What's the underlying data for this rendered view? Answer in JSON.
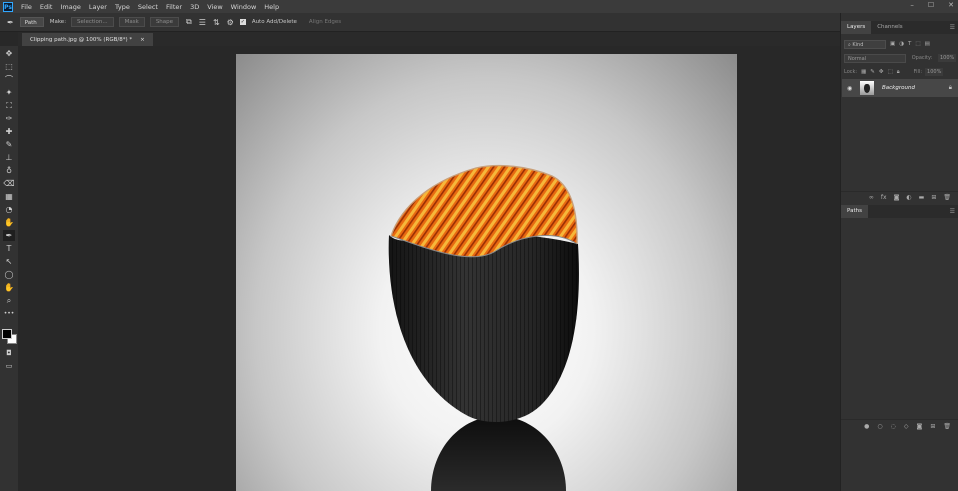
{
  "app": {
    "logo": "Ps"
  },
  "menu": [
    "File",
    "Edit",
    "Image",
    "Layer",
    "Type",
    "Select",
    "Filter",
    "3D",
    "View",
    "Window",
    "Help"
  ],
  "window_controls": [
    "–",
    "☐",
    "✕"
  ],
  "options": {
    "mode": "Path",
    "make_label": "Make:",
    "selection_btn": "Selection...",
    "mask_btn": "Mask",
    "shape_btn": "Shape",
    "auto_add_delete": "Auto Add/Delete",
    "align_edges": "Align Edges"
  },
  "document": {
    "tab_title": "Clipping path.jpg @ 100% (RGB/8*) *",
    "close": "×"
  },
  "tools": [
    "✥",
    "⬚",
    "⌒",
    "✦",
    "⛶",
    "✑",
    "✚",
    "✎",
    "⊥",
    "♁",
    "⌫",
    "▦",
    "◔",
    "✋",
    "✒",
    "T",
    "↖",
    "◯",
    "✋",
    "⌕",
    "•••"
  ],
  "layers_panel": {
    "tabs": [
      "Layers",
      "Channels"
    ],
    "kind_placeholder": "Kind",
    "blend_mode": "Normal",
    "opacity_label": "Opacity:",
    "opacity_value": "100%",
    "lock_label": "Lock:",
    "fill_label": "Fill:",
    "fill_value": "100%",
    "layers": [
      {
        "name": "Background",
        "visible": true,
        "locked": true
      }
    ]
  },
  "paths_panel": {
    "tabs": [
      "Paths"
    ]
  },
  "colors": {
    "accent": "#31a8ff",
    "panel": "#323232",
    "canvas_bg": "#282828"
  }
}
